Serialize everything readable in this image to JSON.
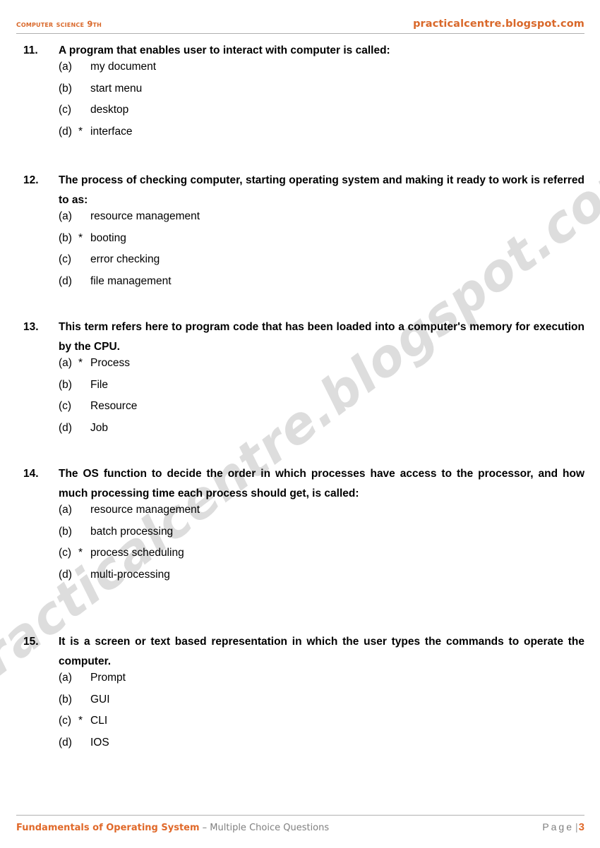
{
  "header": {
    "left_title": "Computer Science 9th",
    "right_site": "practicalcentre.blogspot.com"
  },
  "watermark": {
    "text": "practicalcentre.blogspot.com"
  },
  "questions": [
    {
      "number": "11.",
      "text": "A program that enables user to interact with computer is called:",
      "multiline": false,
      "options": [
        {
          "label": "(a)",
          "star": "",
          "text": "my document"
        },
        {
          "label": "(b)",
          "star": "",
          "text": "start menu"
        },
        {
          "label": "(c)",
          "star": "",
          "text": "desktop"
        },
        {
          "label": "(d)",
          "star": "*",
          "text": "interface"
        }
      ]
    },
    {
      "number": "12.",
      "text": "The process of checking computer, starting operating system and making it ready to work is referred to as:",
      "multiline": true,
      "options": [
        {
          "label": "(a)",
          "star": "",
          "text": "resource management"
        },
        {
          "label": "(b)",
          "star": "*",
          "text": "booting"
        },
        {
          "label": "(c)",
          "star": "",
          "text": "error checking"
        },
        {
          "label": "(d)",
          "star": "",
          "text": "file management"
        }
      ]
    },
    {
      "number": "13.",
      "text": "This term refers here to program code that has been loaded into a computer's memory for execution by the CPU.",
      "multiline": true,
      "options": [
        {
          "label": "(a)",
          "star": "*",
          "text": "Process"
        },
        {
          "label": "(b)",
          "star": "",
          "text": "File"
        },
        {
          "label": "(c)",
          "star": "",
          "text": "Resource"
        },
        {
          "label": "(d)",
          "star": "",
          "text": "Job"
        }
      ]
    },
    {
      "number": "14.",
      "text": "The OS function to decide the order in which processes have access to the processor, and how much processing time each process should get, is called:",
      "multiline": true,
      "options": [
        {
          "label": "(a)",
          "star": "",
          "text": "resource management"
        },
        {
          "label": "(b)",
          "star": "",
          "text": "batch processing"
        },
        {
          "label": "(c)",
          "star": "*",
          "text": "process scheduling"
        },
        {
          "label": "(d)",
          "star": "",
          "text": "multi-processing"
        }
      ]
    },
    {
      "number": "15.",
      "text": "It is a screen or text based representation in which the user types the commands to operate the computer.",
      "multiline": true,
      "options": [
        {
          "label": "(a)",
          "star": "",
          "text": "Prompt"
        },
        {
          "label": "(b)",
          "star": "",
          "text": "GUI"
        },
        {
          "label": "(c)",
          "star": "*",
          "text": "CLI"
        },
        {
          "label": "(d)",
          "star": "",
          "text": "IOS"
        }
      ]
    }
  ],
  "footer": {
    "title": "Fundamentals of Operating System",
    "dash": " – ",
    "subtitle": "Multiple Choice Questions",
    "page_word": "Page",
    "page_separator": "|",
    "page_number": "3"
  },
  "colors": {
    "accent_orange": "#e0692a",
    "rule_gray": "#b0b0b0",
    "muted_gray": "#808080",
    "watermark_gray": "#c9c9c9",
    "text_black": "#000000"
  }
}
